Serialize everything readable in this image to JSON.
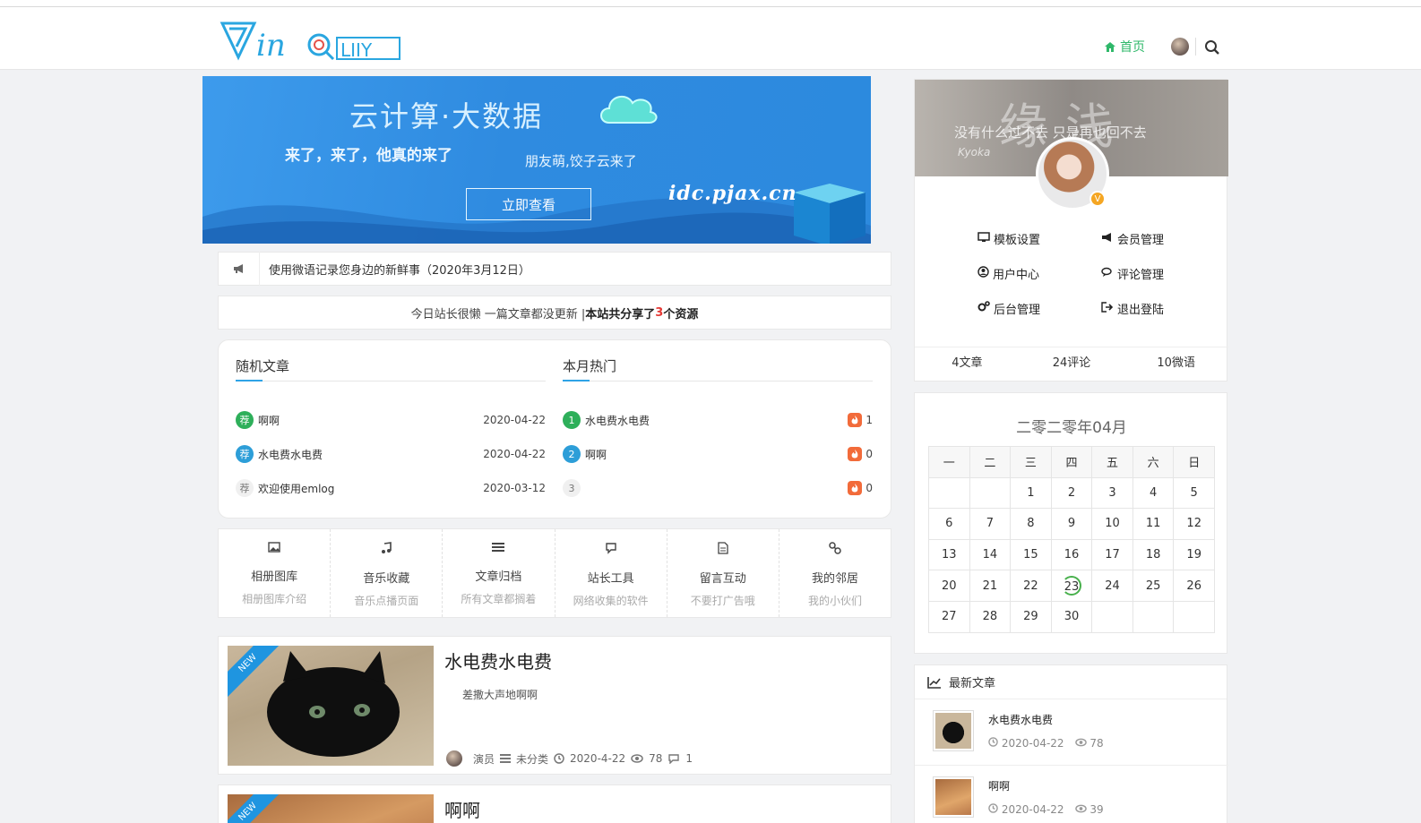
{
  "nav": {
    "home": "首页"
  },
  "banner": {
    "title": "云计算·大数据",
    "sub1": "来了，来了，他真的来了",
    "sub2": "朋友萌,饺子云来了",
    "button": "立即查看",
    "url": "idc.pjax.cn"
  },
  "notice": {
    "text": "使用微语记录您身边的新鲜事（2020年3月12日）"
  },
  "stat": {
    "prefix": "今日站长很懒 一篇文章都没更新 | ",
    "bold1": "本站共分享了",
    "count": "3",
    "bold2": "个资源"
  },
  "random": {
    "title": "随机文章",
    "items": [
      {
        "badge": "荐",
        "title": "啊啊",
        "date": "2020-04-22",
        "color": "#2eaf5a"
      },
      {
        "badge": "荐",
        "title": "水电费水电费",
        "date": "2020-04-22",
        "color": "#2d9ed8"
      },
      {
        "badge": "荐",
        "title": "欢迎使用emlog",
        "date": "2020-03-12",
        "color": "#f0f0f0"
      }
    ]
  },
  "hot": {
    "title": "本月热门",
    "items": [
      {
        "rank": "1",
        "title": "水电费水电费",
        "count": "1",
        "color": "#2eaf5a"
      },
      {
        "rank": "2",
        "title": "啊啊",
        "count": "0",
        "color": "#2d9ed8"
      },
      {
        "rank": "3",
        "title": "",
        "count": "0",
        "color": "#f0f0f0"
      }
    ]
  },
  "menu": [
    {
      "icon": "image-icon",
      "title": "相册图库",
      "sub": "相册图库介绍"
    },
    {
      "icon": "music-icon",
      "title": "音乐收藏",
      "sub": "音乐点播页面"
    },
    {
      "icon": "list-icon",
      "title": "文章归档",
      "sub": "所有文章都搁着"
    },
    {
      "icon": "chat-icon",
      "title": "站长工具",
      "sub": "网络收集的软件"
    },
    {
      "icon": "document-icon",
      "title": "留言互动",
      "sub": "不要打广告哦"
    },
    {
      "icon": "link-icon",
      "title": "我的邻居",
      "sub": "我的小伙们"
    }
  ],
  "post1": {
    "ribbon": "NEW",
    "title": "水电费水电费",
    "excerpt": "差撒大声地啊啊",
    "author": "演员",
    "category": "未分类",
    "date": "2020-4-22",
    "views": "78",
    "comments": "1"
  },
  "post2": {
    "ribbon": "NEW",
    "title": "啊啊"
  },
  "profile": {
    "slogan": "没有什么过不去 只是再也回不去",
    "big": "缘浅",
    "kyoka": "Kyoka",
    "vbadge": "V",
    "links": [
      "模板设置",
      "会员管理",
      "用户中心",
      "评论管理",
      "后台管理",
      "退出登陆"
    ],
    "counts": [
      "4文章",
      "24评论",
      "10微语"
    ]
  },
  "calendar": {
    "title": "二零二零年04月",
    "weekdays": [
      "一",
      "二",
      "三",
      "四",
      "五",
      "六",
      "日"
    ],
    "weeks": [
      [
        "",
        "",
        "1",
        "2",
        "3",
        "4",
        "5"
      ],
      [
        "6",
        "7",
        "8",
        "9",
        "10",
        "11",
        "12"
      ],
      [
        "13",
        "14",
        "15",
        "16",
        "17",
        "18",
        "19"
      ],
      [
        "20",
        "21",
        "22",
        "23",
        "24",
        "25",
        "26"
      ],
      [
        "27",
        "28",
        "29",
        "30",
        "",
        "",
        ""
      ]
    ],
    "today": "23"
  },
  "latest": {
    "title": "最新文章",
    "items": [
      {
        "title": "水电费水电费",
        "date": "2020-04-22",
        "views": "78"
      },
      {
        "title": "啊啊",
        "date": "2020-04-22",
        "views": "39"
      }
    ]
  }
}
